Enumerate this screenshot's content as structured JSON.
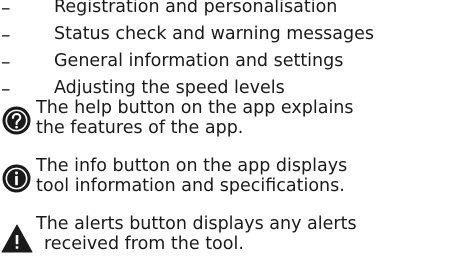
{
  "bullets": [
    {
      "dash": "–",
      "text": "Registration and personalisation"
    },
    {
      "dash": "–",
      "text": "Status check and warning messages"
    },
    {
      "dash": "–",
      "text": "General information and settings"
    },
    {
      "dash": "–",
      "text": "Adjusting the speed levels"
    }
  ],
  "notes": {
    "help": {
      "icon": "help-question-icon",
      "line1": "The help button on the app explains",
      "line2": "the features of the app."
    },
    "info": {
      "icon": "info-icon",
      "line1": "The info button on the app displays",
      "line2": "tool information and specifications."
    },
    "alerts": {
      "icon": "warning-triangle-icon",
      "line1": "The alerts button displays any alerts",
      "line2": "received from the tool."
    }
  },
  "colors": {
    "text": "#1a1a1a",
    "icon_fill": "#1a1a1a",
    "icon_glyph": "#ffffff"
  }
}
